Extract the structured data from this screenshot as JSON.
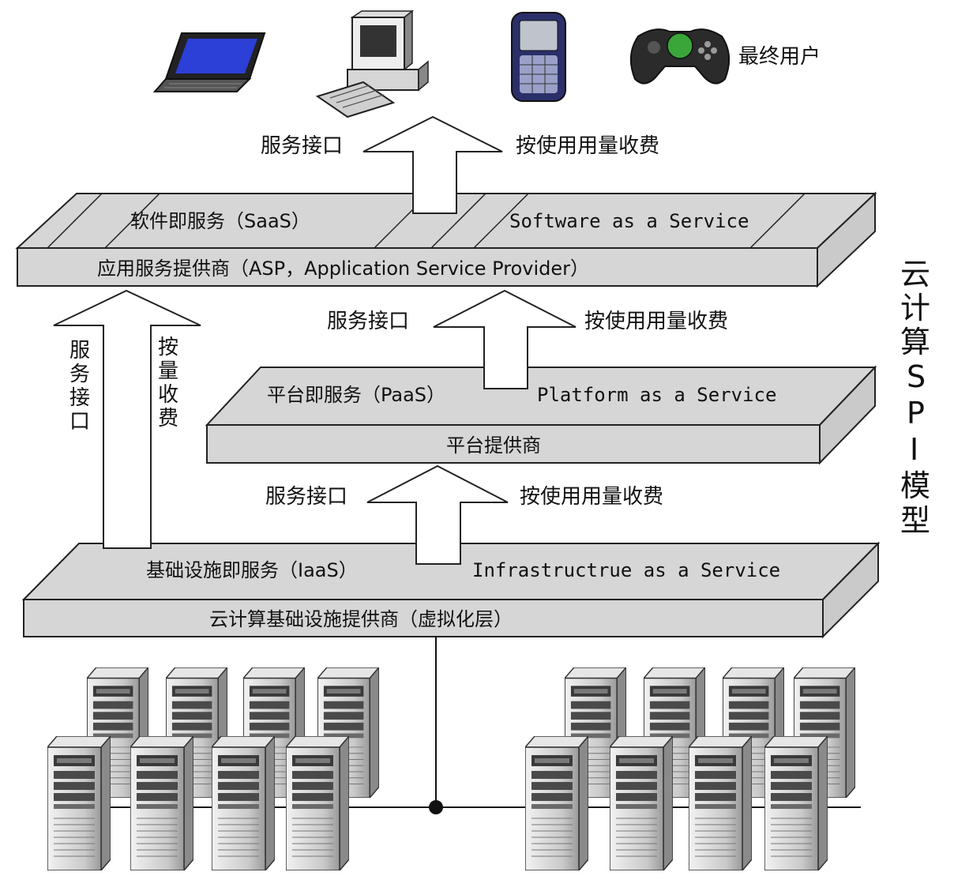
{
  "end_users": {
    "label": "最终用户",
    "devices": [
      "laptop-icon",
      "desktop-computer-icon",
      "smartphone-icon",
      "gamepad-icon"
    ]
  },
  "saas": {
    "top_cn": "软件即服务（SaaS）",
    "top_en": "Software as a Service",
    "front": "应用服务提供商（ASP，Application Service Provider）",
    "arrow_left": "服务接口",
    "arrow_right": "按使用用量收费"
  },
  "paas": {
    "top_cn": "平台即服务（PaaS）",
    "top_en": "Platform as a Service",
    "front": "平台提供商",
    "arrow_left": "服务接口",
    "arrow_right": "按使用用量收费"
  },
  "iaas": {
    "top_cn": "基础设施即服务（IaaS）",
    "top_en": "Infrastructrue as a Service",
    "front": "云计算基础设施提供商（虚拟化层）",
    "arrow_left": "服务接口",
    "arrow_right": "按使用用量收费"
  },
  "bypass_arrow": {
    "left": [
      "服",
      "务",
      "接",
      "口"
    ],
    "right": [
      "按",
      "量",
      "收",
      "费"
    ]
  },
  "model_title": [
    "云",
    "计",
    "算",
    "S",
    "P",
    "I",
    "模",
    "型"
  ],
  "servers": {
    "icon": "server-tower-icon"
  }
}
